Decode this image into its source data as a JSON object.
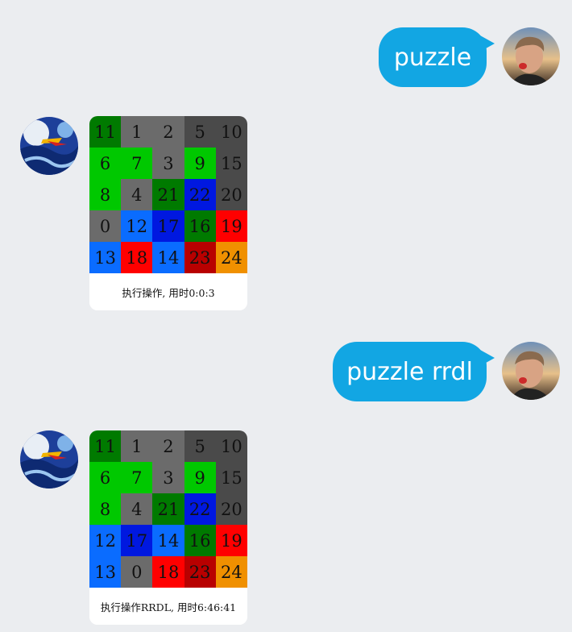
{
  "messages": [
    {
      "text": "puzzle"
    },
    {
      "tiles": [
        {
          "label": "11",
          "color": "#007a00"
        },
        {
          "label": "1",
          "color": "#6b6b6b"
        },
        {
          "label": "2",
          "color": "#6b6b6b"
        },
        {
          "label": "5",
          "color": "#4a4a4a"
        },
        {
          "label": "10",
          "color": "#4a4a4a"
        },
        {
          "label": "6",
          "color": "#00c800"
        },
        {
          "label": "7",
          "color": "#00c800"
        },
        {
          "label": "3",
          "color": "#6b6b6b"
        },
        {
          "label": "9",
          "color": "#00c800"
        },
        {
          "label": "15",
          "color": "#4a4a4a"
        },
        {
          "label": "8",
          "color": "#00c800"
        },
        {
          "label": "4",
          "color": "#6b6b6b"
        },
        {
          "label": "21",
          "color": "#007a00"
        },
        {
          "label": "22",
          "color": "#0018e0"
        },
        {
          "label": "20",
          "color": "#4a4a4a"
        },
        {
          "label": "0",
          "color": "#6b6b6b"
        },
        {
          "label": "12",
          "color": "#0a6cff"
        },
        {
          "label": "17",
          "color": "#0018e0"
        },
        {
          "label": "16",
          "color": "#007a00"
        },
        {
          "label": "19",
          "color": "#ff0000"
        },
        {
          "label": "13",
          "color": "#0a6cff"
        },
        {
          "label": "18",
          "color": "#ff0000"
        },
        {
          "label": "14",
          "color": "#0a6cff"
        },
        {
          "label": "23",
          "color": "#b80000"
        },
        {
          "label": "24",
          "color": "#f09000"
        }
      ],
      "caption": "执行操作, 用时0:0:3"
    },
    {
      "text": "puzzle rrdl"
    },
    {
      "tiles": [
        {
          "label": "11",
          "color": "#007a00"
        },
        {
          "label": "1",
          "color": "#6b6b6b"
        },
        {
          "label": "2",
          "color": "#6b6b6b"
        },
        {
          "label": "5",
          "color": "#4a4a4a"
        },
        {
          "label": "10",
          "color": "#4a4a4a"
        },
        {
          "label": "6",
          "color": "#00c800"
        },
        {
          "label": "7",
          "color": "#00c800"
        },
        {
          "label": "3",
          "color": "#6b6b6b"
        },
        {
          "label": "9",
          "color": "#00c800"
        },
        {
          "label": "15",
          "color": "#4a4a4a"
        },
        {
          "label": "8",
          "color": "#00c800"
        },
        {
          "label": "4",
          "color": "#6b6b6b"
        },
        {
          "label": "21",
          "color": "#007a00"
        },
        {
          "label": "22",
          "color": "#0018e0"
        },
        {
          "label": "20",
          "color": "#4a4a4a"
        },
        {
          "label": "12",
          "color": "#0a6cff"
        },
        {
          "label": "17",
          "color": "#0018e0"
        },
        {
          "label": "14",
          "color": "#0a6cff"
        },
        {
          "label": "16",
          "color": "#007a00"
        },
        {
          "label": "19",
          "color": "#ff0000"
        },
        {
          "label": "13",
          "color": "#0a6cff"
        },
        {
          "label": "0",
          "color": "#6b6b6b"
        },
        {
          "label": "18",
          "color": "#ff0000"
        },
        {
          "label": "23",
          "color": "#b80000"
        },
        {
          "label": "24",
          "color": "#f09000"
        }
      ],
      "caption": "执行操作RRDL, 用时6:46:41"
    }
  ],
  "colors": {
    "background": "#ebedf0",
    "sent_bubble": "#12a6e3",
    "sent_text": "#ffffff"
  }
}
